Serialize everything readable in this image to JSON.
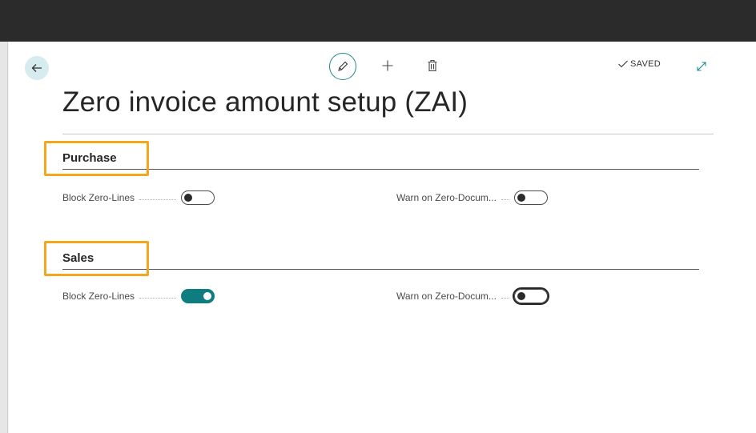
{
  "page": {
    "title": "Zero invoice amount setup (ZAI)",
    "status": "SAVED"
  },
  "sections": {
    "purchase": {
      "header": "Purchase",
      "block_label": "Block Zero-Lines",
      "block_value": false,
      "warn_label": "Warn on Zero-Docum...",
      "warn_value": false
    },
    "sales": {
      "header": "Sales",
      "block_label": "Block Zero-Lines",
      "block_value": true,
      "warn_label": "Warn on Zero-Docum...",
      "warn_value": false
    }
  },
  "colors": {
    "accent": "#0f7c80",
    "highlight": "#f4a61c"
  }
}
